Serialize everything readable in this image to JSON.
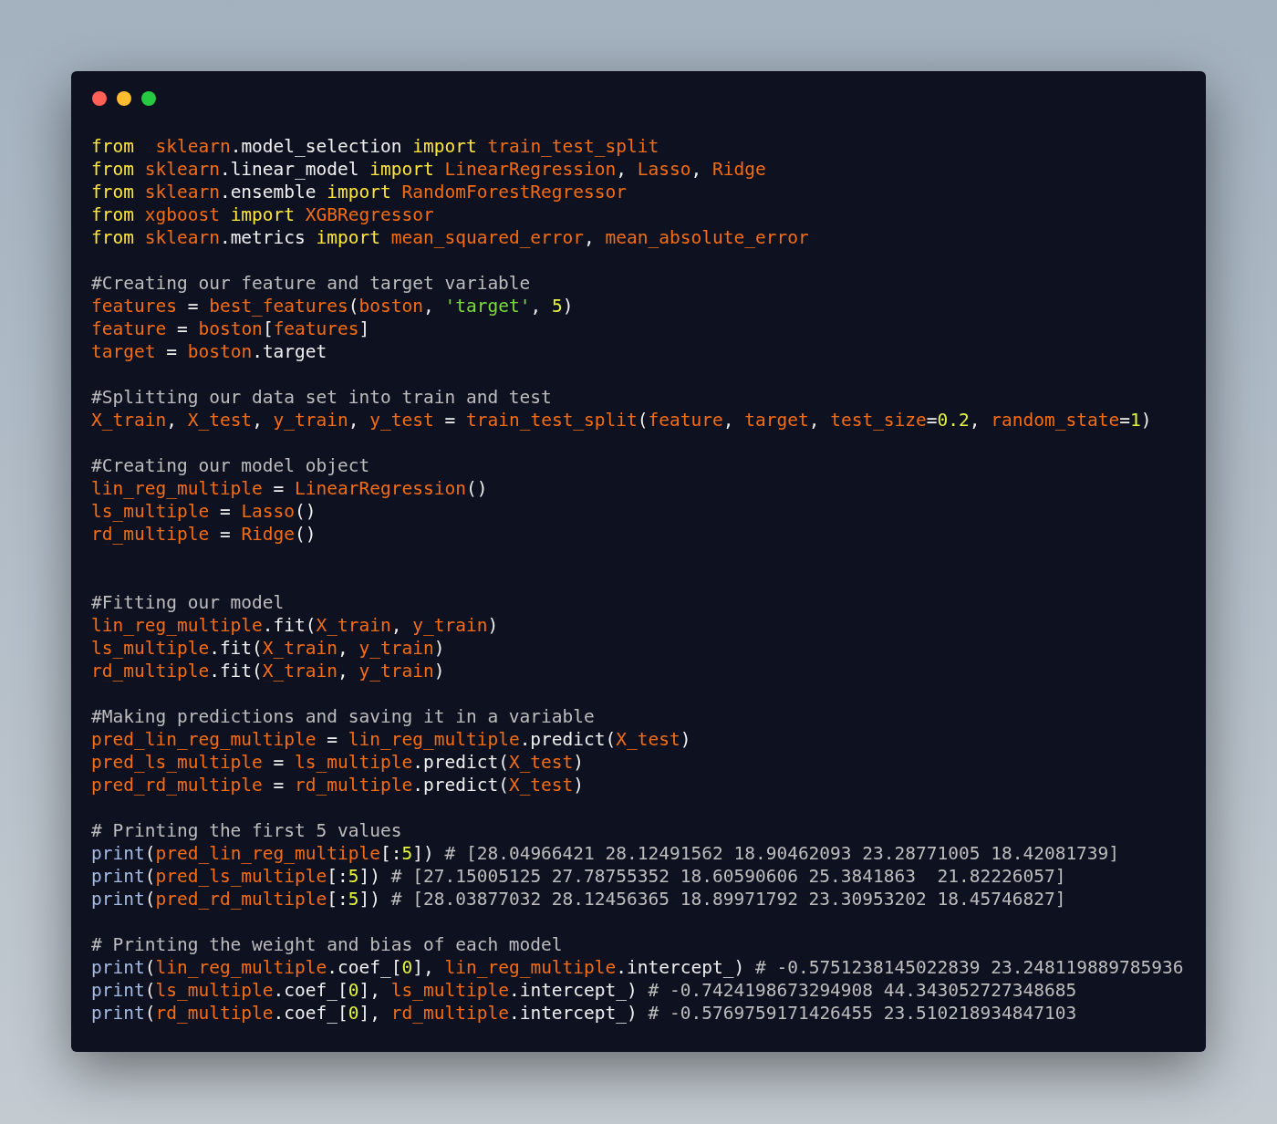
{
  "code_lines": [
    {
      "kind": "code",
      "tokens": [
        {
          "text": "from  ",
          "kind": "keyword"
        },
        {
          "text": "sklearn",
          "kind": "name"
        },
        {
          "text": ".model_selection ",
          "kind": "plain"
        },
        {
          "text": "import ",
          "kind": "keyword"
        },
        {
          "text": "train_test_split",
          "kind": "name"
        }
      ]
    },
    {
      "kind": "code",
      "tokens": [
        {
          "text": "from ",
          "kind": "keyword"
        },
        {
          "text": "sklearn",
          "kind": "name"
        },
        {
          "text": ".linear_model ",
          "kind": "plain"
        },
        {
          "text": "import ",
          "kind": "keyword"
        },
        {
          "text": "LinearRegression",
          "kind": "name"
        },
        {
          "text": ", ",
          "kind": "plain"
        },
        {
          "text": "Lasso",
          "kind": "name"
        },
        {
          "text": ", ",
          "kind": "plain"
        },
        {
          "text": "Ridge",
          "kind": "name"
        }
      ]
    },
    {
      "kind": "code",
      "tokens": [
        {
          "text": "from ",
          "kind": "keyword"
        },
        {
          "text": "sklearn",
          "kind": "name"
        },
        {
          "text": ".ensemble ",
          "kind": "plain"
        },
        {
          "text": "import ",
          "kind": "keyword"
        },
        {
          "text": "RandomForestRegressor",
          "kind": "name"
        }
      ]
    },
    {
      "kind": "code",
      "tokens": [
        {
          "text": "from ",
          "kind": "keyword"
        },
        {
          "text": "xgboost ",
          "kind": "name"
        },
        {
          "text": "import ",
          "kind": "keyword"
        },
        {
          "text": "XGBRegressor",
          "kind": "name"
        }
      ]
    },
    {
      "kind": "code",
      "tokens": [
        {
          "text": "from ",
          "kind": "keyword"
        },
        {
          "text": "sklearn",
          "kind": "name"
        },
        {
          "text": ".metrics ",
          "kind": "plain"
        },
        {
          "text": "import ",
          "kind": "keyword"
        },
        {
          "text": "mean_squared_error",
          "kind": "name"
        },
        {
          "text": ", ",
          "kind": "plain"
        },
        {
          "text": "mean_absolute_error",
          "kind": "name"
        }
      ]
    },
    {
      "kind": "blank"
    },
    {
      "kind": "code",
      "tokens": [
        {
          "text": "#Creating our feature and target variable",
          "kind": "comment"
        }
      ]
    },
    {
      "kind": "code",
      "tokens": [
        {
          "text": "features",
          "kind": "name"
        },
        {
          "text": " = ",
          "kind": "plain"
        },
        {
          "text": "best_features",
          "kind": "name"
        },
        {
          "text": "(",
          "kind": "plain"
        },
        {
          "text": "boston",
          "kind": "name"
        },
        {
          "text": ", ",
          "kind": "plain"
        },
        {
          "text": "'target'",
          "kind": "string"
        },
        {
          "text": ", ",
          "kind": "plain"
        },
        {
          "text": "5",
          "kind": "number"
        },
        {
          "text": ")",
          "kind": "plain"
        }
      ]
    },
    {
      "kind": "code",
      "tokens": [
        {
          "text": "feature",
          "kind": "name"
        },
        {
          "text": " = ",
          "kind": "plain"
        },
        {
          "text": "boston",
          "kind": "name"
        },
        {
          "text": "[",
          "kind": "plain"
        },
        {
          "text": "features",
          "kind": "name"
        },
        {
          "text": "]",
          "kind": "plain"
        }
      ]
    },
    {
      "kind": "code",
      "tokens": [
        {
          "text": "target",
          "kind": "name"
        },
        {
          "text": " = ",
          "kind": "plain"
        },
        {
          "text": "boston",
          "kind": "name"
        },
        {
          "text": ".target",
          "kind": "plain"
        }
      ]
    },
    {
      "kind": "blank"
    },
    {
      "kind": "code",
      "tokens": [
        {
          "text": "#Splitting our data set into train and test",
          "kind": "comment"
        }
      ]
    },
    {
      "kind": "code",
      "tokens": [
        {
          "text": "X_train",
          "kind": "name"
        },
        {
          "text": ", ",
          "kind": "plain"
        },
        {
          "text": "X_test",
          "kind": "name"
        },
        {
          "text": ", ",
          "kind": "plain"
        },
        {
          "text": "y_train",
          "kind": "name"
        },
        {
          "text": ", ",
          "kind": "plain"
        },
        {
          "text": "y_test",
          "kind": "name"
        },
        {
          "text": " = ",
          "kind": "plain"
        },
        {
          "text": "train_test_split",
          "kind": "name"
        },
        {
          "text": "(",
          "kind": "plain"
        },
        {
          "text": "feature",
          "kind": "name"
        },
        {
          "text": ", ",
          "kind": "plain"
        },
        {
          "text": "target",
          "kind": "name"
        },
        {
          "text": ", ",
          "kind": "plain"
        },
        {
          "text": "test_size",
          "kind": "name"
        },
        {
          "text": "=",
          "kind": "plain"
        },
        {
          "text": "0.2",
          "kind": "number"
        },
        {
          "text": ", ",
          "kind": "plain"
        },
        {
          "text": "random_state",
          "kind": "name"
        },
        {
          "text": "=",
          "kind": "plain"
        },
        {
          "text": "1",
          "kind": "number"
        },
        {
          "text": ")",
          "kind": "plain"
        }
      ]
    },
    {
      "kind": "blank"
    },
    {
      "kind": "code",
      "tokens": [
        {
          "text": "#Creating our model object",
          "kind": "comment"
        }
      ]
    },
    {
      "kind": "code",
      "tokens": [
        {
          "text": "lin_reg_multiple",
          "kind": "name"
        },
        {
          "text": " = ",
          "kind": "plain"
        },
        {
          "text": "LinearRegression",
          "kind": "name"
        },
        {
          "text": "()",
          "kind": "plain"
        }
      ]
    },
    {
      "kind": "code",
      "tokens": [
        {
          "text": "ls_multiple",
          "kind": "name"
        },
        {
          "text": " = ",
          "kind": "plain"
        },
        {
          "text": "Lasso",
          "kind": "name"
        },
        {
          "text": "()",
          "kind": "plain"
        }
      ]
    },
    {
      "kind": "code",
      "tokens": [
        {
          "text": "rd_multiple",
          "kind": "name"
        },
        {
          "text": " = ",
          "kind": "plain"
        },
        {
          "text": "Ridge",
          "kind": "name"
        },
        {
          "text": "()",
          "kind": "plain"
        }
      ]
    },
    {
      "kind": "blank"
    },
    {
      "kind": "blank"
    },
    {
      "kind": "code",
      "tokens": [
        {
          "text": "#Fitting our model",
          "kind": "comment"
        }
      ]
    },
    {
      "kind": "code",
      "tokens": [
        {
          "text": "lin_reg_multiple",
          "kind": "name"
        },
        {
          "text": ".fit(",
          "kind": "plain"
        },
        {
          "text": "X_train",
          "kind": "name"
        },
        {
          "text": ", ",
          "kind": "plain"
        },
        {
          "text": "y_train",
          "kind": "name"
        },
        {
          "text": ")",
          "kind": "plain"
        }
      ]
    },
    {
      "kind": "code",
      "tokens": [
        {
          "text": "ls_multiple",
          "kind": "name"
        },
        {
          "text": ".fit(",
          "kind": "plain"
        },
        {
          "text": "X_train",
          "kind": "name"
        },
        {
          "text": ", ",
          "kind": "plain"
        },
        {
          "text": "y_train",
          "kind": "name"
        },
        {
          "text": ")",
          "kind": "plain"
        }
      ]
    },
    {
      "kind": "code",
      "tokens": [
        {
          "text": "rd_multiple",
          "kind": "name"
        },
        {
          "text": ".fit(",
          "kind": "plain"
        },
        {
          "text": "X_train",
          "kind": "name"
        },
        {
          "text": ", ",
          "kind": "plain"
        },
        {
          "text": "y_train",
          "kind": "name"
        },
        {
          "text": ")",
          "kind": "plain"
        }
      ]
    },
    {
      "kind": "blank"
    },
    {
      "kind": "code",
      "tokens": [
        {
          "text": "#Making predictions and saving it in a variable",
          "kind": "comment"
        }
      ]
    },
    {
      "kind": "code",
      "tokens": [
        {
          "text": "pred_lin_reg_multiple",
          "kind": "name"
        },
        {
          "text": " = ",
          "kind": "plain"
        },
        {
          "text": "lin_reg_multiple",
          "kind": "name"
        },
        {
          "text": ".predict(",
          "kind": "plain"
        },
        {
          "text": "X_test",
          "kind": "name"
        },
        {
          "text": ")",
          "kind": "plain"
        }
      ]
    },
    {
      "kind": "code",
      "tokens": [
        {
          "text": "pred_ls_multiple",
          "kind": "name"
        },
        {
          "text": " = ",
          "kind": "plain"
        },
        {
          "text": "ls_multiple",
          "kind": "name"
        },
        {
          "text": ".predict(",
          "kind": "plain"
        },
        {
          "text": "X_test",
          "kind": "name"
        },
        {
          "text": ")",
          "kind": "plain"
        }
      ]
    },
    {
      "kind": "code",
      "tokens": [
        {
          "text": "pred_rd_multiple",
          "kind": "name"
        },
        {
          "text": " = ",
          "kind": "plain"
        },
        {
          "text": "rd_multiple",
          "kind": "name"
        },
        {
          "text": ".predict(",
          "kind": "plain"
        },
        {
          "text": "X_test",
          "kind": "name"
        },
        {
          "text": ")",
          "kind": "plain"
        }
      ]
    },
    {
      "kind": "blank"
    },
    {
      "kind": "code",
      "tokens": [
        {
          "text": "# Printing the first 5 values",
          "kind": "comment"
        }
      ]
    },
    {
      "kind": "code",
      "tokens": [
        {
          "text": "print",
          "kind": "builtin"
        },
        {
          "text": "(",
          "kind": "plain"
        },
        {
          "text": "pred_lin_reg_multiple",
          "kind": "name"
        },
        {
          "text": "[:",
          "kind": "plain"
        },
        {
          "text": "5",
          "kind": "number"
        },
        {
          "text": "])",
          "kind": "plain"
        },
        {
          "text": " # [28.04966421 28.12491562 18.90462093 23.28771005 18.42081739]",
          "kind": "comment"
        }
      ]
    },
    {
      "kind": "code",
      "tokens": [
        {
          "text": "print",
          "kind": "builtin"
        },
        {
          "text": "(",
          "kind": "plain"
        },
        {
          "text": "pred_ls_multiple",
          "kind": "name"
        },
        {
          "text": "[:",
          "kind": "plain"
        },
        {
          "text": "5",
          "kind": "number"
        },
        {
          "text": "])",
          "kind": "plain"
        },
        {
          "text": " # [27.15005125 27.78755352 18.60590606 25.3841863  21.82226057]",
          "kind": "comment"
        }
      ]
    },
    {
      "kind": "code",
      "tokens": [
        {
          "text": "print",
          "kind": "builtin"
        },
        {
          "text": "(",
          "kind": "plain"
        },
        {
          "text": "pred_rd_multiple",
          "kind": "name"
        },
        {
          "text": "[:",
          "kind": "plain"
        },
        {
          "text": "5",
          "kind": "number"
        },
        {
          "text": "])",
          "kind": "plain"
        },
        {
          "text": " # [28.03877032 28.12456365 18.89971792 23.30953202 18.45746827]",
          "kind": "comment"
        }
      ]
    },
    {
      "kind": "blank"
    },
    {
      "kind": "code",
      "tokens": [
        {
          "text": "# Printing the weight and bias of each model",
          "kind": "comment"
        }
      ]
    },
    {
      "kind": "code",
      "tokens": [
        {
          "text": "print",
          "kind": "builtin"
        },
        {
          "text": "(",
          "kind": "plain"
        },
        {
          "text": "lin_reg_multiple",
          "kind": "name"
        },
        {
          "text": ".coef_[",
          "kind": "plain"
        },
        {
          "text": "0",
          "kind": "number"
        },
        {
          "text": "], ",
          "kind": "plain"
        },
        {
          "text": "lin_reg_multiple",
          "kind": "name"
        },
        {
          "text": ".intercept_)",
          "kind": "plain"
        },
        {
          "text": " # -0.5751238145022839 23.248119889785936",
          "kind": "comment"
        }
      ]
    },
    {
      "kind": "code",
      "tokens": [
        {
          "text": "print",
          "kind": "builtin"
        },
        {
          "text": "(",
          "kind": "plain"
        },
        {
          "text": "ls_multiple",
          "kind": "name"
        },
        {
          "text": ".coef_[",
          "kind": "plain"
        },
        {
          "text": "0",
          "kind": "number"
        },
        {
          "text": "], ",
          "kind": "plain"
        },
        {
          "text": "ls_multiple",
          "kind": "name"
        },
        {
          "text": ".intercept_)",
          "kind": "plain"
        },
        {
          "text": " # -0.7424198673294908 44.343052727348685",
          "kind": "comment"
        }
      ]
    },
    {
      "kind": "code",
      "tokens": [
        {
          "text": "print",
          "kind": "builtin"
        },
        {
          "text": "(",
          "kind": "plain"
        },
        {
          "text": "rd_multiple",
          "kind": "name"
        },
        {
          "text": ".coef_[",
          "kind": "plain"
        },
        {
          "text": "0",
          "kind": "number"
        },
        {
          "text": "], ",
          "kind": "plain"
        },
        {
          "text": "rd_multiple",
          "kind": "name"
        },
        {
          "text": ".intercept_)",
          "kind": "plain"
        },
        {
          "text": " # -0.5769759171426455 23.510218934847103",
          "kind": "comment"
        }
      ]
    }
  ]
}
